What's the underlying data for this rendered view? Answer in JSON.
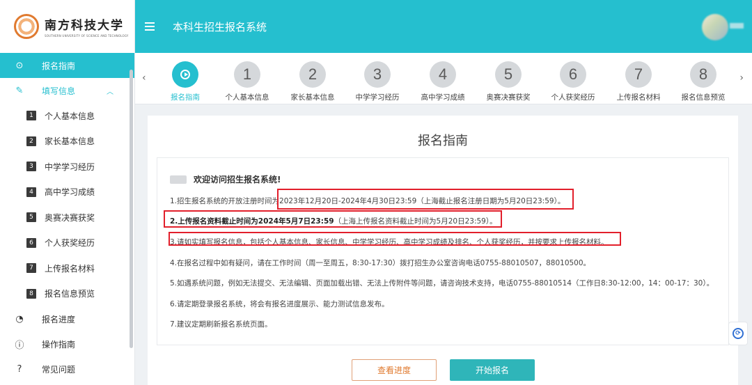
{
  "logo": {
    "cn": "南方科技大学",
    "en": "SOUTHERN UNIVERSITY OF SCIENCE AND TECHNOLOGY"
  },
  "header": {
    "title": "本科生招生报名系统"
  },
  "sidebar": {
    "guide": "报名指南",
    "fill": "填写信息",
    "sub_items": [
      {
        "num": "1",
        "label": "个人基本信息"
      },
      {
        "num": "2",
        "label": "家长基本信息"
      },
      {
        "num": "3",
        "label": "中学学习经历"
      },
      {
        "num": "4",
        "label": "高中学习成绩"
      },
      {
        "num": "5",
        "label": "奥赛决赛获奖"
      },
      {
        "num": "6",
        "label": "个人获奖经历"
      },
      {
        "num": "7",
        "label": "上传报名材料"
      },
      {
        "num": "8",
        "label": "报名信息预览"
      }
    ],
    "progress": "报名进度",
    "operation": "操作指南",
    "faq": "常见问题"
  },
  "steps": [
    {
      "num": "",
      "label": "报名指南"
    },
    {
      "num": "1",
      "label": "个人基本信息"
    },
    {
      "num": "2",
      "label": "家长基本信息"
    },
    {
      "num": "3",
      "label": "中学学习经历"
    },
    {
      "num": "4",
      "label": "高中学习成绩"
    },
    {
      "num": "5",
      "label": "奥赛决赛获奖"
    },
    {
      "num": "6",
      "label": "个人获奖经历"
    },
    {
      "num": "7",
      "label": "上传报名材料"
    },
    {
      "num": "8",
      "label": "报名信息预览"
    }
  ],
  "main": {
    "title": "报名指南",
    "welcome": "欢迎访问招生报名系统!",
    "line1": "1.招生报名系统的开放注册时间为2023年12月20日-2024年4月30日23:59（上海截止报名注册日期为5月20日23:59）。",
    "line2_bold": "2.上传报名资料截止时间为2024年5月7日23:59",
    "line2_rest": "（上海上传报名资料截止时间为5月20日23:59）。",
    "line3": "3.请如实填写报名信息，包括个人基本信息、家长信息、中学学习经历、高中学习成绩及排名、个人获奖经历，并按要求上传报名材料。",
    "line4": "4.在报名过程中如有疑问，请在工作时间（周一至周五，8:30-17:30）拨打招生办公室咨询电话0755-88010507，88010500。",
    "line5": "5.如遇系统问题，例如无法提交、无法编辑、页面加载出错、无法上传附件等问题，请咨询技术支持，电话0755-88010514（工作日8:30-12:00，14：00-17：30）。",
    "line6": "6.请定期登录报名系统，将会有报名进度展示、能力测试信息发布。",
    "line7": "7.建议定期刷新报名系统页面。",
    "btn_progress": "查看进度",
    "btn_start": "开始报名"
  }
}
